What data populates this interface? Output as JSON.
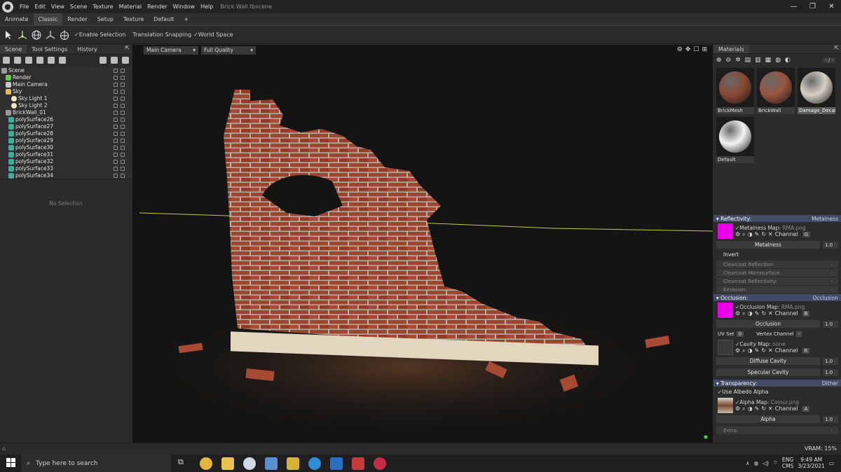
{
  "menubar": {
    "items": [
      "File",
      "Edit",
      "View",
      "Scene",
      "Texture",
      "Material",
      "Render",
      "Window",
      "Help"
    ],
    "title": "Brick Wall.tbscene"
  },
  "tabs": [
    "Animate",
    "Classic",
    "Render",
    "Setup",
    "Texture",
    "Default",
    "+"
  ],
  "toolbar": {
    "enable_selection": "Enable Selection",
    "translation_snapping": "Translation Snapping",
    "world_space": "World Space"
  },
  "left_panel": {
    "tabs": [
      "Scene",
      "Tool Settings",
      "History"
    ],
    "tree": [
      {
        "label": "Scene",
        "icon": "scene-icon"
      },
      {
        "label": "Render",
        "icon": "render-icon"
      },
      {
        "label": "Main Camera",
        "icon": "camera-icon"
      },
      {
        "label": "Sky",
        "icon": "sky-icon"
      },
      {
        "label": "Sky Light 1",
        "icon": "light-icon"
      },
      {
        "label": "Sky Light 2",
        "icon": "light-icon"
      },
      {
        "label": "BrickWall_01",
        "icon": "group-icon"
      },
      {
        "label": "polySurface26",
        "icon": "mesh-icon"
      },
      {
        "label": "polySurface27",
        "icon": "mesh-icon"
      },
      {
        "label": "polySurface28",
        "icon": "mesh-icon"
      },
      {
        "label": "polySurface29",
        "icon": "mesh-icon"
      },
      {
        "label": "polySurface30",
        "icon": "mesh-icon"
      },
      {
        "label": "polySurface31",
        "icon": "mesh-icon"
      },
      {
        "label": "polySurface32",
        "icon": "mesh-icon"
      },
      {
        "label": "polySurface33",
        "icon": "mesh-icon"
      },
      {
        "label": "polySurface34",
        "icon": "mesh-icon"
      }
    ],
    "no_selection": "No Selection"
  },
  "viewport": {
    "camera": "Main Camera",
    "quality": "Full Quality"
  },
  "materials": {
    "tab": "Materials",
    "page": "- / -",
    "items": [
      {
        "label": "BrickMesh",
        "color": "#8a4a34"
      },
      {
        "label": "BrickWall",
        "color": "#9a5540"
      },
      {
        "label": "Damage_Decals",
        "color": "#d8d0c8"
      },
      {
        "label": "Default",
        "color": "#f4f4f4"
      }
    ],
    "reflectivity": {
      "title": "Reflectivity:",
      "mode": "Metalness",
      "map_label": "Metalness Map:",
      "map_file": "RMA.png",
      "channel_label": "Channel",
      "channel": "G",
      "metalness_label": "Metalness",
      "metalness_value": "1.0",
      "invert": "Invert"
    },
    "collapsed": [
      {
        "label": "Clearcoat Reflection:",
        "value": "-"
      },
      {
        "label": "Clearcoat Microsurface:",
        "value": "-"
      },
      {
        "label": "Clearcoat Reflectivity:",
        "value": "-"
      },
      {
        "label": "Emission:",
        "value": "-"
      }
    ],
    "occlusion": {
      "title": "Occlusion:",
      "mode": "Occlusion",
      "map_label": "Occlusion Map:",
      "map_file": "RMA.png",
      "channel_label": "Channel",
      "channel": "B",
      "occlusion_label": "Occlusion",
      "occlusion_value": "1.0",
      "uv_set_label": "UV Set",
      "uv_set": "0",
      "vertex_channel_label": "Vertex Channel",
      "vertex_channel": "-",
      "cavity_label": "Cavity Map:",
      "cavity_file": "none",
      "cavity_channel": "R",
      "diffuse_cavity": "Diffuse Cavity",
      "diffuse_cavity_value": "1.0",
      "specular_cavity": "Specular Cavity",
      "specular_cavity_value": "1.0"
    },
    "transparency": {
      "title": "Transparency:",
      "mode": "Dither",
      "use_albedo": "Use Albedo Alpha",
      "map_label": "Alpha Map:",
      "map_file": "Colour.png",
      "channel_label": "Channel",
      "channel": "A",
      "alpha_label": "Alpha",
      "alpha_value": "1.0"
    },
    "extra": "Extra:"
  },
  "status": {
    "vram": "VRAM: 15%"
  },
  "taskbar": {
    "search": "Type here to search",
    "lang1": "ENG",
    "lang2": "CMS",
    "time": "9:49 AM",
    "date": "3/23/2021"
  }
}
